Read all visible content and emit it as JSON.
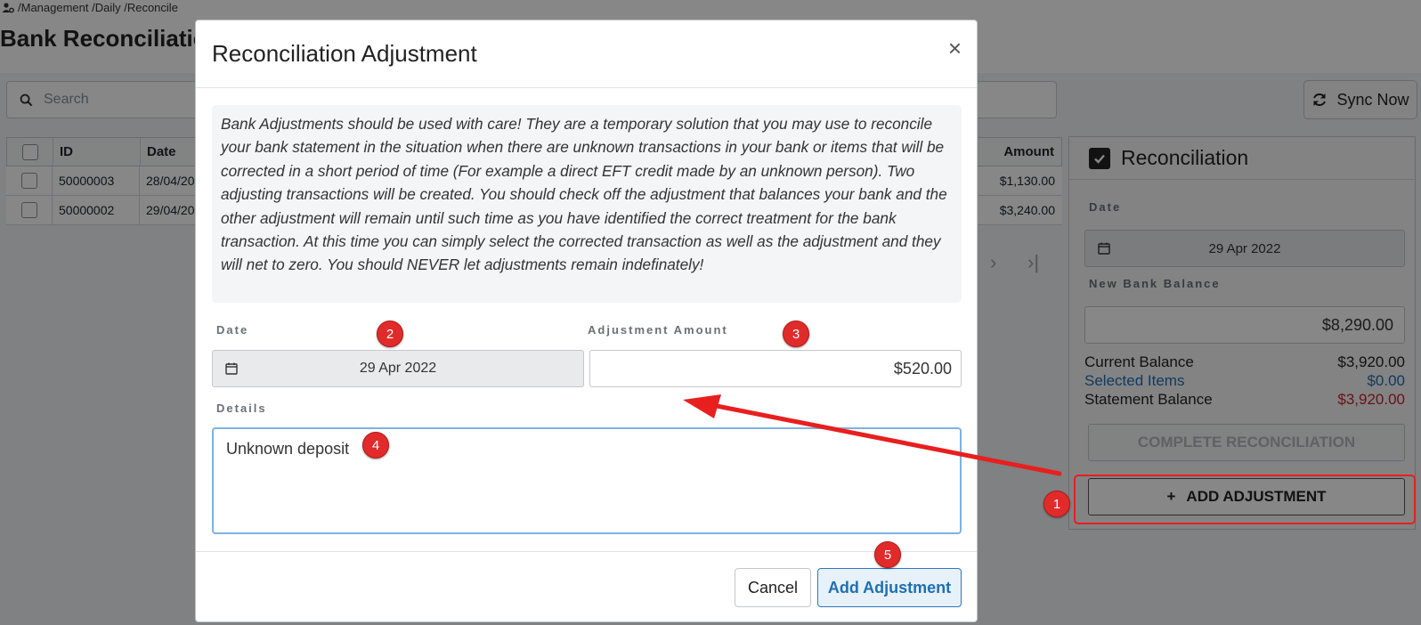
{
  "breadcrumb": {
    "text": "/Management /Daily /Reconcile"
  },
  "page": {
    "title": "Bank Reconciliation"
  },
  "search": {
    "placeholder": "Search"
  },
  "sync": {
    "label": "Sync Now"
  },
  "table": {
    "headers": {
      "id": "ID",
      "date": "Date",
      "amount": "Amount"
    },
    "rows": [
      {
        "id": "50000003",
        "date": "28/04/20",
        "amount": "$1,130.00"
      },
      {
        "id": "50000002",
        "date": "29/04/20",
        "amount": "$3,240.00"
      }
    ],
    "pager": {
      "next": "›",
      "last": "›|"
    }
  },
  "reconciliation": {
    "title": "Reconciliation",
    "date_label": "Date",
    "date_value": "29 Apr 2022",
    "new_balance_label": "New Bank Balance",
    "new_balance_value": "$8,290.00",
    "current_balance_label": "Current Balance",
    "current_balance_value": "$3,920.00",
    "selected_items_label": "Selected Items",
    "selected_items_value": "$0.00",
    "statement_balance_label": "Statement Balance",
    "statement_balance_value": "$3,920.00",
    "complete_label": "COMPLETE RECONCILIATION",
    "add_adjustment_label": "ADD ADJUSTMENT",
    "add_adjustment_icon": "+"
  },
  "modal": {
    "title": "Reconciliation Adjustment",
    "close": "×",
    "warning": "Bank Adjustments should be used with care! They are a temporary solution that you may use to reconcile your bank statement in the situation when there are unknown transactions in your bank or items that will be corrected in a short period of time (For example a direct EFT credit made by an unknown person). Two adjusting transactions will be created. You should check off the adjustment that balances your bank and the other adjustment will remain until such time as you have identified the correct treatment for the bank transaction. At this time you can simply select the corrected transaction as well as the adjustment and they will net to zero. You should NEVER let adjustments remain indefinately!",
    "date_label": "Date",
    "date_value": "29 Apr 2022",
    "amount_label": "Adjustment Amount",
    "amount_value": "$520.00",
    "details_label": "Details",
    "details_value": "Unknown deposit",
    "cancel_label": "Cancel",
    "submit_label": "Add Adjustment"
  },
  "annotations": {
    "badges": [
      "1",
      "2",
      "3",
      "4",
      "5"
    ]
  },
  "colors": {
    "accent_blue": "#1f6fb2",
    "statement_red": "#c0262d",
    "annotation_red": "#e12b2b"
  }
}
